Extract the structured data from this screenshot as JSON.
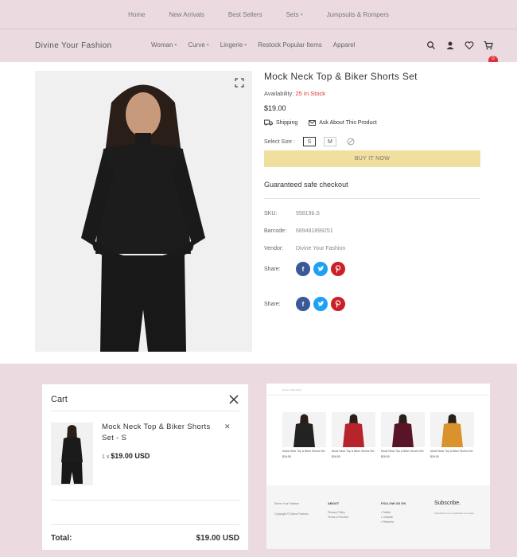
{
  "topnav": [
    {
      "label": "Home",
      "chevron": false
    },
    {
      "label": "New Arrivals",
      "chevron": false
    },
    {
      "label": "Best Sellers",
      "chevron": false
    },
    {
      "label": "Sets",
      "chevron": true
    },
    {
      "label": "Jumpsuits & Rompers",
      "chevron": false
    }
  ],
  "header": {
    "logo": "Divine Your Fashion",
    "nav": [
      {
        "label": "Woman",
        "chevron": true
      },
      {
        "label": "Curve",
        "chevron": true
      },
      {
        "label": "Lingerie",
        "chevron": true
      },
      {
        "label": "Restock Popular Items",
        "chevron": false
      },
      {
        "label": "Apparel",
        "chevron": false
      }
    ],
    "cart_count": "0"
  },
  "product": {
    "title": "Mock Neck Top & Biker Shorts Set",
    "availability_label": "Availability:",
    "availability_value": "25 In Stock",
    "price": "$19.00",
    "shipping": "Shipping",
    "ask": "Ask About This Product",
    "size_label": "Select Size :",
    "sizes": [
      "S",
      "M"
    ],
    "buy": "BUY IT NOW",
    "guarantee": "Guaranteed safe checkout",
    "meta": [
      {
        "k": "SKU:",
        "v": "55819b.S"
      },
      {
        "k": "Barcode:",
        "v": "689481899251"
      },
      {
        "k": "Vendor:",
        "v": "Divine Your Fashion"
      }
    ],
    "share_label": "Share:"
  },
  "cart": {
    "title": "Cart",
    "item_name": "Mock Neck Top & Biker Shorts Set - S",
    "item_qty": "1 x",
    "item_price": "$19.00 USD",
    "total_label": "Total:",
    "total_value": "$19.00 USD"
  },
  "mini": {
    "breadcrumb": "Home / Sets Ruch",
    "products": [
      {
        "name": "Mock Neck Top & Biker Shorts Set",
        "price": "$19.00",
        "color": "#222222"
      },
      {
        "name": "Mock Neck Top & Biker Shorts Set",
        "price": "$19.00",
        "color": "#b8242b"
      },
      {
        "name": "Mock Neck Top & Biker Shorts Set",
        "price": "$19.00",
        "color": "#5a1428"
      },
      {
        "name": "Mock Neck Top & Biker Shorts Set",
        "price": "$19.00",
        "color": "#d9922c"
      }
    ],
    "footer": {
      "brand": "Divine Your Fashion",
      "copyright": "Copyright © Divine Fashion",
      "about_h": "ABOUT",
      "about": [
        "Privacy Policy",
        "Terms of Service"
      ],
      "follow_h": "FOLLOW US ON",
      "follow": [
        "Twitter",
        "Linkedin",
        "Pinterest"
      ],
      "subscribe": "Subscribe.",
      "subscribe_text": "Subscribe to our newsletter to receive"
    }
  }
}
